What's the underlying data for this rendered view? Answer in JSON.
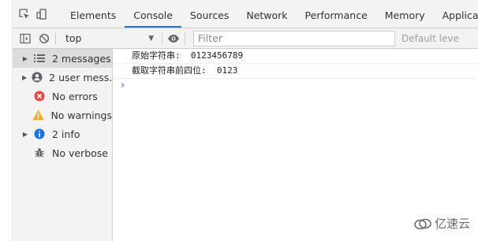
{
  "tabs": [
    {
      "label": "Elements"
    },
    {
      "label": "Console"
    },
    {
      "label": "Sources"
    },
    {
      "label": "Network"
    },
    {
      "label": "Performance"
    },
    {
      "label": "Memory"
    },
    {
      "label": "Application"
    }
  ],
  "active_tab": "Console",
  "toolbar": {
    "context": "top",
    "filter_placeholder": "Filter",
    "levels_label": "Default leve"
  },
  "sidebar": {
    "items": [
      {
        "label": "2 messages",
        "icon": "list-icon",
        "selected": true
      },
      {
        "label": "2 user mess...",
        "icon": "user-icon"
      },
      {
        "label": "No errors",
        "icon": "error-icon"
      },
      {
        "label": "No warnings",
        "icon": "warning-icon"
      },
      {
        "label": "2 info",
        "icon": "info-icon"
      },
      {
        "label": "No verbose",
        "icon": "bug-icon"
      }
    ]
  },
  "console": {
    "lines": [
      {
        "text": "原始字符串:  0123456789"
      },
      {
        "text": "截取字符串前四位:  0123"
      }
    ],
    "prompt": "›"
  },
  "watermark": {
    "text": "亿速云"
  },
  "colors": {
    "accent": "#1a73e8",
    "error": "#e8473f",
    "warning": "#f2ab26",
    "info": "#1a73e8"
  }
}
